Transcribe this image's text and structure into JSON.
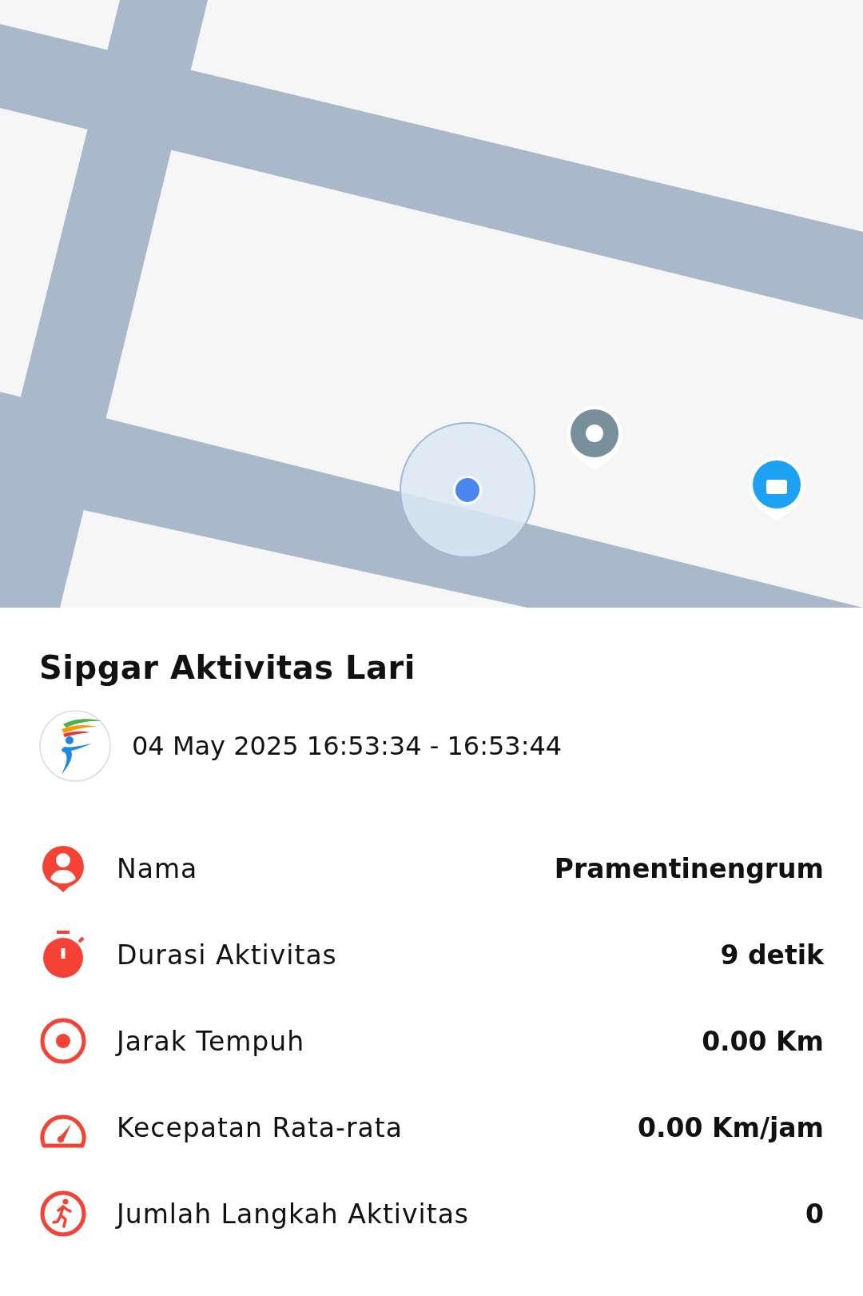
{
  "title": "Sipgar Aktivitas Lari",
  "session": {
    "time_range": "04 May 2025 16:53:34 - 16:53:44"
  },
  "stats": [
    {
      "kind": "person",
      "label": "Nama",
      "value": "Pramentinengrum"
    },
    {
      "kind": "stopwatch",
      "label": "Durasi Aktivitas",
      "value": "9 detik"
    },
    {
      "kind": "target",
      "label": "Jarak Tempuh",
      "value": "0.00 Km"
    },
    {
      "kind": "speedometer",
      "label": "Kecepatan Rata-rata",
      "value": "0.00 Km/jam"
    },
    {
      "kind": "runner",
      "label": "Jumlah Langkah Aktivitas",
      "value": "0"
    }
  ]
}
